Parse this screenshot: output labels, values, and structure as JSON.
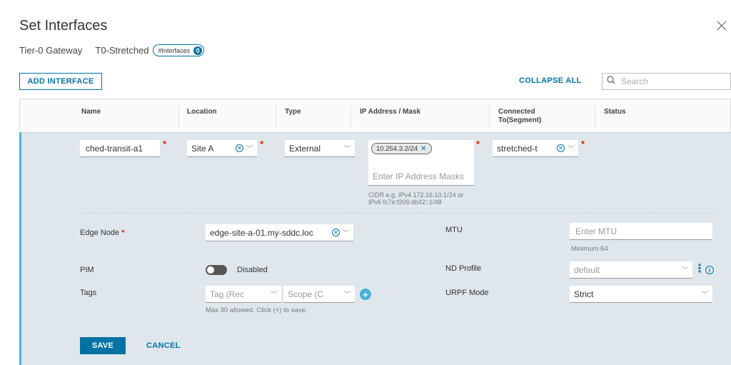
{
  "modal": {
    "title": "Set Interfaces",
    "gateway_type_label": "Tier-0 Gateway",
    "gateway_name": "T0-Stretched",
    "badge_label": "#Interfaces",
    "badge_count": "0"
  },
  "toolbar": {
    "add_interface_label": "ADD INTERFACE",
    "collapse_all_label": "COLLAPSE ALL",
    "search_placeholder": "Search"
  },
  "table": {
    "columns": [
      "Name",
      "Location",
      "Type",
      "IP Address / Mask",
      "Connected To(Segment)",
      "Status"
    ]
  },
  "row": {
    "name_value": "ched-transit-a1",
    "location_value": "Site A",
    "type_value": "External",
    "ip_chip": "10.254.3.2/24",
    "ip_placeholder": "Enter IP Address Masks",
    "ip_hint_line1": "CIDR e.g. IPv4 172.16.10.1/24 or",
    "ip_hint_line2": "IPv6 fc7e:f206:db42::1/48",
    "segment_value": "stretched-t",
    "edge_node_label": "Edge Node",
    "edge_node_value": "edge-site-a-01.my-sddc.loc",
    "mtu_label": "MTU",
    "mtu_placeholder": "Enter MTU",
    "mtu_hint": "Minimum 64",
    "pim_label": "PIM",
    "pim_state": "Disabled",
    "nd_profile_label": "ND Profile",
    "nd_profile_value": "default",
    "tags_label": "Tags",
    "tag_placeholder": "Tag (Rec",
    "scope_placeholder": "Scope (C",
    "tags_hint": "Max 30 allowed. Click (+) to save.",
    "urpf_label": "URPF Mode",
    "urpf_value": "Strict",
    "save_label": "SAVE",
    "cancel_label": "CANCEL"
  },
  "colors": {
    "accent": "#0072a3",
    "row_background": "#dfe7ed",
    "row_indicator": "#49afd9",
    "required": "#e12200"
  }
}
